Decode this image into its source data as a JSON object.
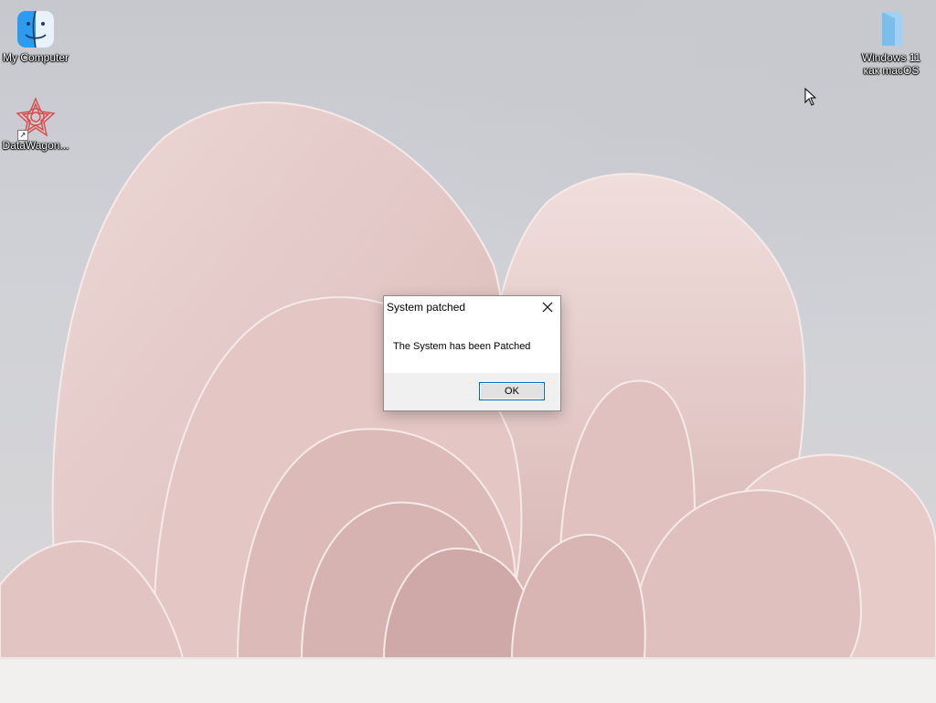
{
  "desktop": {
    "icons": [
      {
        "label": "My Computer",
        "icon": "finder-icon"
      },
      {
        "label": "DataWagon...",
        "icon": "datawagon-icon"
      },
      {
        "label_line1": "Windows 11",
        "label_line2": "как macOS",
        "icon": "folder-icon"
      }
    ]
  },
  "dialog": {
    "title": "System patched",
    "message": "The System has been Patched",
    "ok_label": "OK"
  },
  "colors": {
    "petal": "#e9cfcd",
    "petal_shadow": "#c8a6a4",
    "accent_border": "#0067c0",
    "taskbar": "#f1f0ef"
  }
}
